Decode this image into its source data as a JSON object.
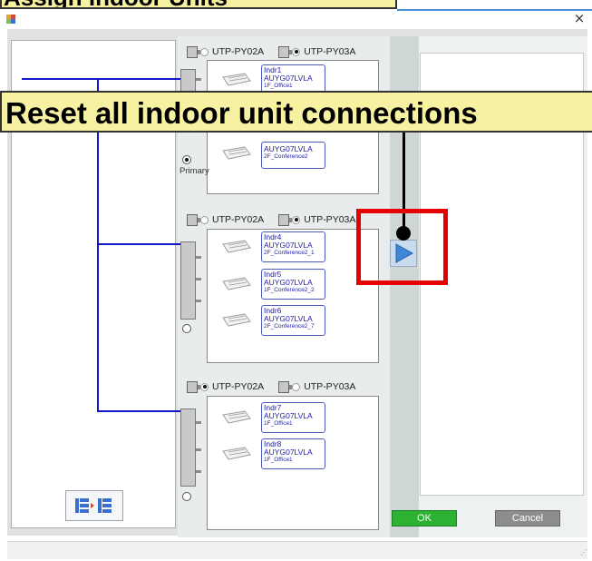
{
  "top_banner": {
    "text": "Assign Indoor Units"
  },
  "window": {
    "close_label": "×"
  },
  "overlay": {
    "text": "Reset all indoor unit connections"
  },
  "controllers": [
    {
      "options": [
        "UTP-PY02A",
        "UTP-PY03A"
      ],
      "selected": "UTP-PY03A",
      "port_label": "Primary",
      "units": [
        {
          "name": "Indr1",
          "model": "AUYG07LVLA",
          "location": "1F_Office1"
        },
        {
          "name": "",
          "model": "AUYG07LVLA",
          "location": "2F_Conference2"
        }
      ]
    },
    {
      "options": [
        "UTP-PY02A",
        "UTP-PY03A"
      ],
      "selected": "UTP-PY03A",
      "units": [
        {
          "name": "Indr4",
          "model": "AUYG07LVLA",
          "location": "2F_Conference2_1"
        },
        {
          "name": "Indr5",
          "model": "AUYG07LVLA",
          "location": "1F_Conference2_2"
        },
        {
          "name": "Indr6",
          "model": "AUYG07LVLA",
          "location": "2F_Conference2_7"
        }
      ]
    },
    {
      "options": [
        "UTP-PY02A",
        "UTP-PY03A"
      ],
      "selected": "UTP-PY02A",
      "units": [
        {
          "name": "Indr7",
          "model": "AUYG07LVLA",
          "location": "1F_Office1"
        },
        {
          "name": "Indr8",
          "model": "AUYG07LVLA",
          "location": "1F_Office1"
        }
      ]
    }
  ],
  "buttons": {
    "ok": "OK",
    "cancel": "Cancel"
  },
  "icons": {
    "move_right": "play-arrow-icon",
    "reset": "reset-connections-icon",
    "app": "app-icon"
  },
  "colors": {
    "accent_blue": "#1414c8",
    "highlight_red": "#e60000",
    "banner_yellow": "#f6f2a2",
    "ok_green": "#2bb233",
    "cancel_gray": "#8d8d8d"
  }
}
